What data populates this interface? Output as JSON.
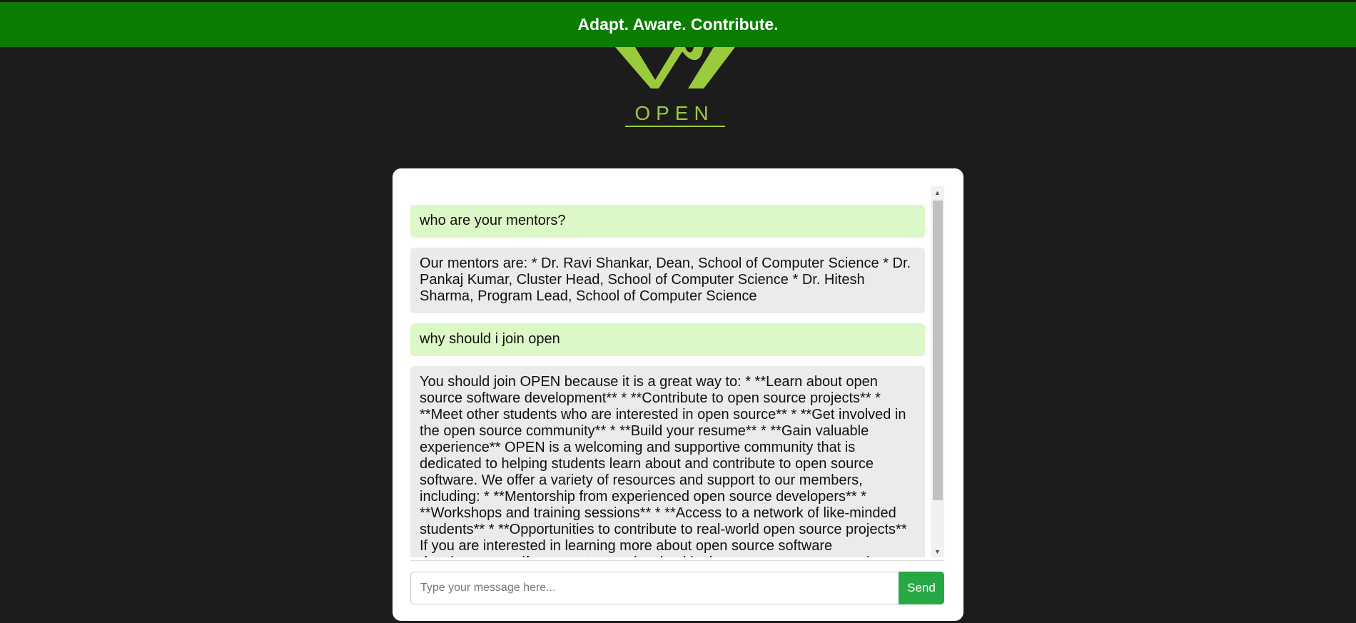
{
  "header": {
    "tagline": "Adapt. Aware. Contribute."
  },
  "logo": {
    "text": "OPEN",
    "color": "#9bcb3c"
  },
  "chat": {
    "messages": [
      {
        "role": "user",
        "text": "who are your mentors?"
      },
      {
        "role": "bot",
        "text": "Our mentors are: * Dr. Ravi Shankar, Dean, School of Computer Science * Dr. Pankaj Kumar, Cluster Head, School of Computer Science * Dr. Hitesh Sharma, Program Lead, School of Computer Science"
      },
      {
        "role": "user",
        "text": "why should i join open"
      },
      {
        "role": "bot",
        "text": "You should join OPEN because it is a great way to: * **Learn about open source software development** * **Contribute to open source projects** * **Meet other students who are interested in open source** * **Get involved in the open source community** * **Build your resume** * **Gain valuable experience** OPEN is a welcoming and supportive community that is dedicated to helping students learn about and contribute to open source software. We offer a variety of resources and support to our members, including: * **Mentorship from experienced open source developers** * **Workshops and training sessions** * **Access to a network of like-minded students** * **Opportunities to contribute to real-world open source projects** If you are interested in learning more about open source software development or if you want to get involved in the open source community"
      }
    ],
    "input_placeholder": "Type your message here...",
    "input_value": "",
    "send_label": "Send"
  },
  "colors": {
    "header_bg": "#0a7d02",
    "page_bg": "#1c1c1c",
    "user_bubble": "#dcf8c6",
    "bot_bubble": "#ebebeb",
    "send_button": "#28a745"
  }
}
